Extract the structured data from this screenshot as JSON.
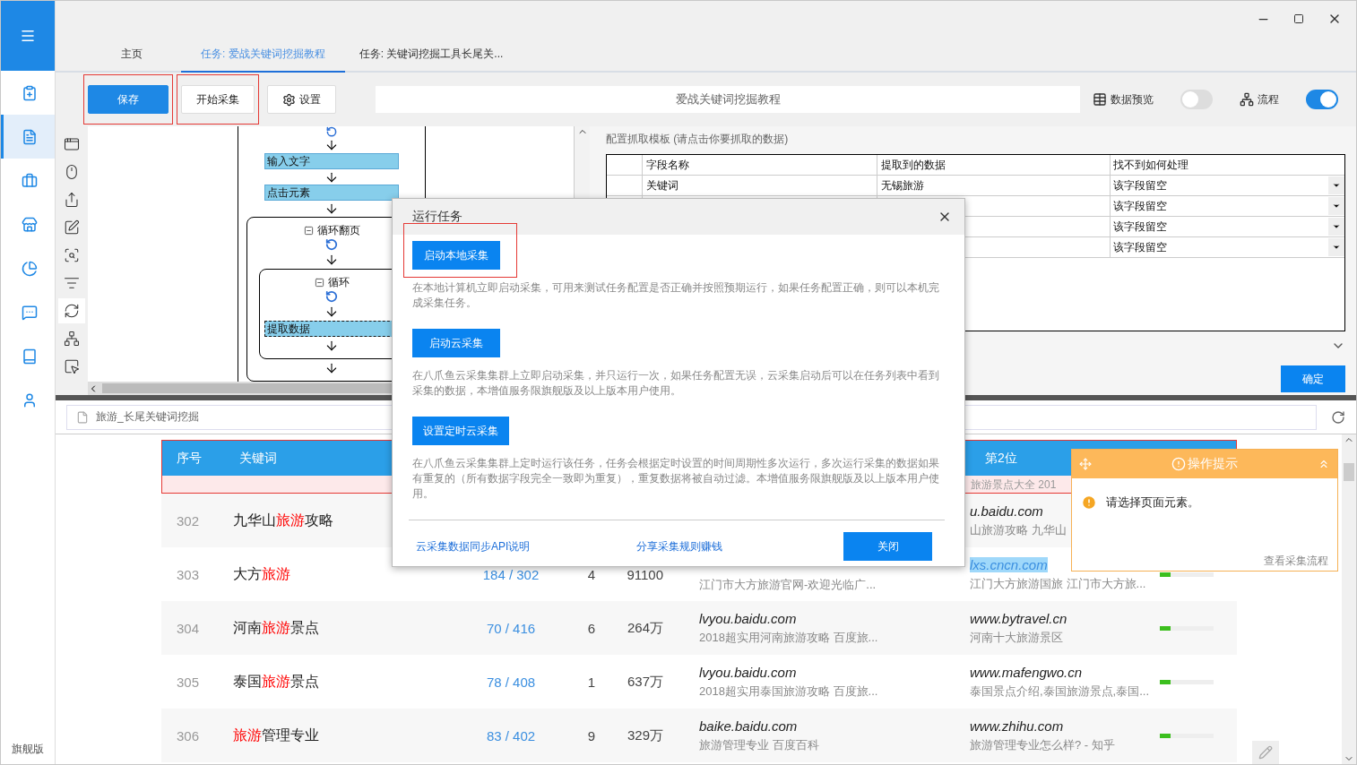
{
  "rail": {
    "footer": "旗舰版",
    "items": [
      {
        "kind": "add",
        "selected": false
      },
      {
        "kind": "task",
        "selected": true
      },
      {
        "kind": "case",
        "selected": false
      },
      {
        "kind": "store",
        "selected": false
      },
      {
        "kind": "chart",
        "selected": false
      },
      {
        "kind": "chat",
        "selected": false
      },
      {
        "kind": "book",
        "selected": false
      },
      {
        "kind": "user",
        "selected": false
      }
    ]
  },
  "tabs": [
    {
      "label": "主页",
      "selected": false
    },
    {
      "label": "任务: 爱战关键词挖掘教程",
      "selected": true
    },
    {
      "label": "任务: 关键词挖掘工具长尾关...",
      "selected": false
    }
  ],
  "toolbar": {
    "save": {
      "label": "保存",
      "highlighted": true
    },
    "start": {
      "label": "开始采集",
      "highlighted": true
    },
    "settings": "设置",
    "task_name": "爱战关键词挖掘教程",
    "preview": {
      "label": "数据预览",
      "on": false
    },
    "flow": {
      "label": "流程",
      "on": true
    }
  },
  "tools": [
    {
      "kind": "page",
      "selected": false
    },
    {
      "kind": "mouse",
      "selected": false
    },
    {
      "kind": "share",
      "selected": false
    },
    {
      "kind": "edit",
      "selected": false
    },
    {
      "kind": "captcha",
      "selected": false
    },
    {
      "kind": "list",
      "selected": false
    },
    {
      "kind": "loop",
      "selected": true
    },
    {
      "kind": "tree",
      "selected": false
    },
    {
      "kind": "pointer",
      "selected": false
    }
  ],
  "flow": {
    "nodes": [
      {
        "kind": "action",
        "label": "输入文字",
        "selected": false
      },
      {
        "kind": "action",
        "label": "点击元素",
        "selected": false
      },
      {
        "kind": "loop",
        "label": "循环翻页",
        "expanded": true,
        "children": [
          {
            "kind": "loop",
            "label": "循环",
            "expanded": true,
            "children": [
              {
                "kind": "action",
                "label": "提取数据",
                "selected": true
              }
            ]
          }
        ]
      }
    ]
  },
  "template": {
    "title": "配置抓取模板 (请点击你要抓取的数据)",
    "columns": [
      "字段名称",
      "提取到的数据",
      "找不到如何处理"
    ],
    "rows": [
      {
        "name": "关键词",
        "value": "无锡旅游",
        "fallback": "该字段留空"
      },
      {
        "fallback": "该字段留空"
      },
      {
        "fallback": "该字段留空"
      },
      {
        "fallback": "该字段留空"
      }
    ],
    "confirm": "确定"
  },
  "browser": {
    "address": "旅游_长尾关键词挖掘",
    "table": {
      "columns": [
        "序号",
        "关键词",
        "第2位"
      ],
      "pink_row": "旅游景点大全 201",
      "rows": [
        {
          "no": "302",
          "keyword": [
            {
              "text": "九华山",
              "hit": false
            },
            {
              "text": "旅游",
              "hit": true
            },
            {
              "text": "攻略",
              "hit": false
            }
          ],
          "site2": "u.baidu.com",
          "desc2": "山旅游攻略 九华山",
          "site2_highlighted": false
        },
        {
          "no": "303",
          "keyword": [
            {
              "text": "大方",
              "hit": false
            },
            {
              "text": "旅游",
              "hit": true
            }
          ],
          "rank": "184 / 302",
          "count": "4",
          "volume": "91100",
          "desc1": "江门市大方旅游官网-欢迎光临广...",
          "site2": "lxs.cncn.com",
          "desc2": "江门大方旅游国旅 江门市大方旅...",
          "site2_highlighted": true,
          "level": 0.2
        },
        {
          "no": "304",
          "keyword": [
            {
              "text": "河南",
              "hit": false
            },
            {
              "text": "旅游",
              "hit": true
            },
            {
              "text": "景点",
              "hit": false
            }
          ],
          "rank": "70 / 416",
          "count": "6",
          "volume": "264万",
          "site1": "lvyou.baidu.com",
          "desc1": "2018超实用河南旅游攻略 百度旅...",
          "site2": "www.bytravel.cn",
          "desc2": "河南十大旅游景区",
          "site2_highlighted": false,
          "level": 0.2
        },
        {
          "no": "305",
          "keyword": [
            {
              "text": "泰国",
              "hit": false
            },
            {
              "text": "旅游",
              "hit": true
            },
            {
              "text": "景点",
              "hit": false
            }
          ],
          "rank": "78 / 408",
          "count": "1",
          "volume": "637万",
          "site1": "lvyou.baidu.com",
          "desc1": "2018超实用泰国旅游攻略 百度旅...",
          "site2": "www.mafengwo.cn",
          "desc2": "泰国景点介绍,泰国旅游景点,泰国...",
          "site2_highlighted": false,
          "level": 0.2
        },
        {
          "no": "306",
          "keyword": [
            {
              "text": "旅游",
              "hit": true
            },
            {
              "text": "管理专业",
              "hit": false
            }
          ],
          "rank": "83 / 402",
          "count": "9",
          "volume": "329万",
          "site1": "baike.baidu.com",
          "desc1": "旅游管理专业 百度百科",
          "site2": "www.zhihu.com",
          "desc2": "旅游管理专业怎么样? - 知乎",
          "site2_highlighted": false,
          "level": 0.2
        }
      ]
    }
  },
  "dialog": {
    "title": "运行任务",
    "options": [
      {
        "button": "启动本地采集",
        "highlighted": true,
        "description": "在本地计算机立即启动采集，可用来测试任务配置是否正确并按照预期运行，如果任务配置正确，则可以本机完成采集任务。"
      },
      {
        "button": "启动云采集",
        "highlighted": false,
        "description": "在八爪鱼云采集集群上立即启动采集，并只运行一次，如果任务配置无误，云采集启动后可以在任务列表中看到采集的数据，本增值服务限旗舰版及以上版本用户使用。"
      },
      {
        "button": "设置定时云采集",
        "highlighted": false,
        "description": "在八爪鱼云采集集群上定时运行该任务，任务会根据定时设置的时间周期性多次运行，多次运行采集的数据如果有重复的（所有数据字段完全一致即为重复），重复数据将被自动过滤。本增值服务限旗舰版及以上版本用户使用。"
      }
    ],
    "links": [
      "云采集数据同步API说明",
      "分享采集规则赚钱"
    ],
    "close": "关闭"
  },
  "tip": {
    "title": "操作提示",
    "message": "请选择页面元素。",
    "link": "查看采集流程"
  }
}
